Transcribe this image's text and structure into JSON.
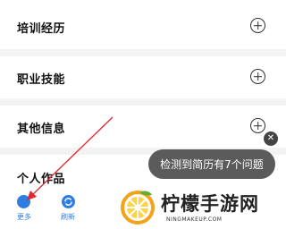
{
  "sections": [
    {
      "label": "培训经历"
    },
    {
      "label": "职业技能"
    },
    {
      "label": "其他信息"
    },
    {
      "label": "个人作品"
    }
  ],
  "toast": {
    "text": "检测到简历有7个问题"
  },
  "toast_close": {
    "glyph": "✕"
  },
  "bottom_nav": {
    "more_label": "更多",
    "refresh_label": "刷新"
  },
  "watermark": {
    "title": "柠檬手游网",
    "sub": "NINGMAKEUP.COM"
  },
  "colors": {
    "accent": "#2f7de1",
    "annotation": "#e0282e",
    "toast_bg": "#5b5b5b"
  }
}
